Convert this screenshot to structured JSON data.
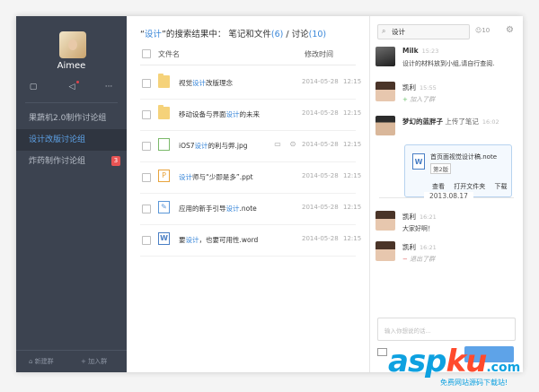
{
  "sidebar": {
    "username": "Aimee",
    "icons": [
      {
        "name": "chat-icon",
        "glyph": "▢"
      },
      {
        "name": "volume-icon",
        "glyph": "◁"
      },
      {
        "name": "more-icon",
        "glyph": "···"
      }
    ],
    "groups": [
      {
        "label": "果蔬机2.0制作讨论组",
        "active": false,
        "badge": null
      },
      {
        "label": "设计改版讨论组",
        "active": true,
        "badge": null
      },
      {
        "label": "炸药制作讨论组",
        "active": false,
        "badge": "3"
      }
    ],
    "new_group": "新建群",
    "join_group": "加入群"
  },
  "results": {
    "quote_open": "“",
    "keyword": "设计",
    "quote_close": "”的搜索结果中：",
    "notes_label": "笔记和文件",
    "notes_count": "(6)",
    "sep": " / ",
    "discussion_label": "讨论",
    "discussion_count": "(10)",
    "col_name": "文件名",
    "col_modified": "修改时间",
    "rows": [
      {
        "icon": "folder-icon",
        "pre": "视觉",
        "hl": "设计",
        "post": "改版理念",
        "date": "2014-05-28",
        "time": "12:15"
      },
      {
        "icon": "folder-icon",
        "pre": "移动设备与界面",
        "hl": "设计",
        "post": "的未来",
        "date": "2014-05-28",
        "time": "12:15"
      },
      {
        "icon": "image-file-icon",
        "pre": "iOS7",
        "hl": "设计",
        "post": "的利与弊.jpg",
        "date": "2014-05-28",
        "time": "12:15"
      },
      {
        "icon": "ppt-file-icon",
        "pre": "",
        "hl": "设计",
        "post": "师与“少即是多”.ppt",
        "date": "2014-05-28",
        "time": "12:15"
      },
      {
        "icon": "note-file-icon",
        "pre": "应用的新手引导",
        "hl": "设计",
        "post": ".note",
        "date": "2014-05-28",
        "time": "12:15"
      },
      {
        "icon": "word-file-icon",
        "pre": "要",
        "hl": "设计",
        "post": "，也要可用性.word",
        "date": "2014-05-28",
        "time": "12:15"
      }
    ]
  },
  "chat": {
    "search_value": "设计",
    "member_count": "10",
    "messages": [
      {
        "name": "Milk",
        "time": "15:23",
        "text": "设计的材料放到小组,请自行查阅."
      },
      {
        "name": "凯利",
        "time": "15:55",
        "sys": "加入了群"
      },
      {
        "name": "梦幻的蓝胖子",
        "action": "上传了笔记",
        "time": "16:02"
      },
      {
        "name": "凯利",
        "time": "16:21",
        "text": "大家好啊！"
      },
      {
        "name": "凯利",
        "time": "16:21",
        "sys": "退出了群"
      }
    ],
    "file_card": {
      "name": "首页面视觉设计稿.note",
      "version": "第2版",
      "actions": [
        "查看",
        "打开文件夹",
        "下载"
      ]
    },
    "date_separator": "2013.08.17",
    "compose_placeholder": "输入你想说的话..."
  },
  "watermark": {
    "brand_a": "asp",
    "brand_b": "ku",
    "brand_c": ".com",
    "sub": "免费网站源码下载站!"
  }
}
